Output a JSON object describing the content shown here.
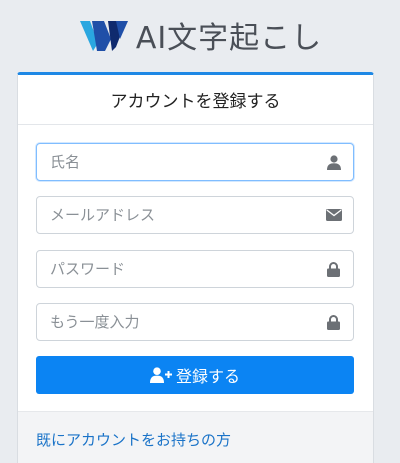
{
  "app": {
    "title": "AI文字起こし",
    "logo_icon": "brand-logo-icon"
  },
  "register": {
    "heading": "アカウントを登録する",
    "name": {
      "placeholder": "氏名",
      "value": "",
      "icon": "user-icon"
    },
    "email": {
      "placeholder": "メールアドレス",
      "value": "",
      "icon": "envelope-icon"
    },
    "password": {
      "placeholder": "パスワード",
      "value": "",
      "icon": "lock-icon"
    },
    "password_confirm": {
      "placeholder": "もう一度入力",
      "value": "",
      "icon": "lock-icon"
    },
    "submit_label": "登録する",
    "submit_icon": "user-plus-icon",
    "login_link": "既にアカウントをお持ちの方"
  },
  "colors": {
    "accent": "#0b84f3",
    "card_top_border": "#1e88e5",
    "link": "#1a73c8",
    "background": "#e9ecf0"
  }
}
